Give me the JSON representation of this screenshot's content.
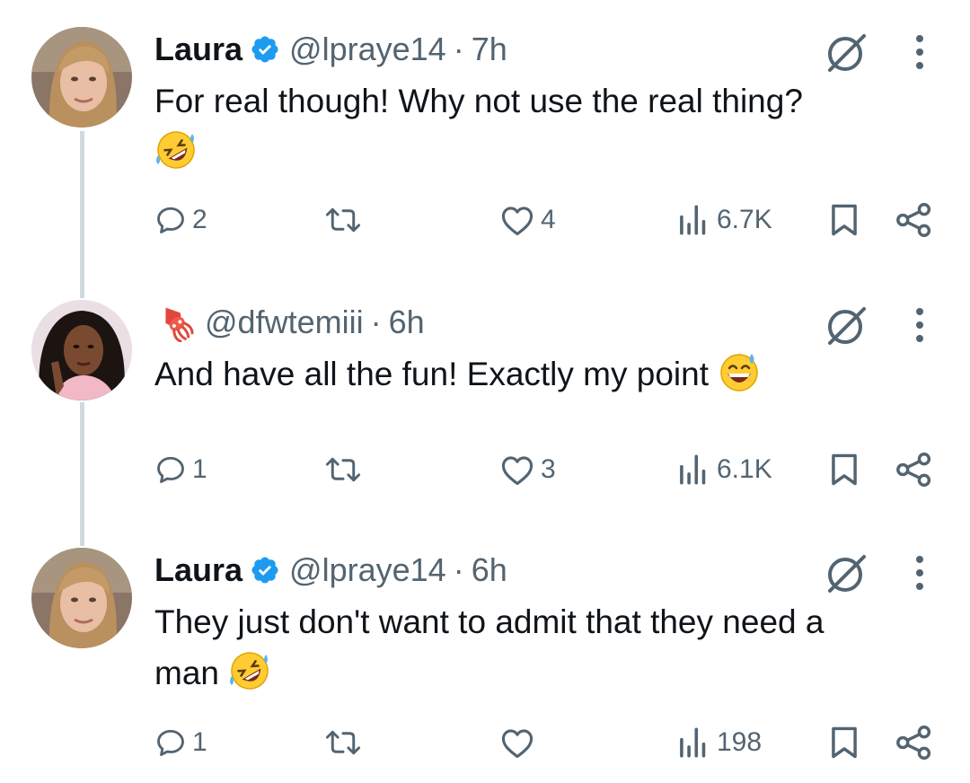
{
  "tweets": [
    {
      "author": "Laura",
      "verified": true,
      "handle": "@lpraye14",
      "time": "7h",
      "text": "For real though! Why not use the real thing?",
      "emoji": "rolling-on-floor-laughing",
      "stats": {
        "replies": "2",
        "retweets": "",
        "likes": "4",
        "views": "6.7K"
      }
    },
    {
      "author_emoji": "squid",
      "handle": "@dfwtemiii",
      "time": "6h",
      "text": "And have all the fun! Exactly my point",
      "emoji": "grinning-sweat",
      "stats": {
        "replies": "1",
        "retweets": "",
        "likes": "3",
        "views": "6.1K"
      }
    },
    {
      "author": "Laura",
      "verified": true,
      "handle": "@lpraye14",
      "time": "6h",
      "text": "They just don't want to admit that they need a",
      "text_line2": "man",
      "emoji": "rolling-on-floor-laughing",
      "stats": {
        "replies": "1",
        "retweets": "",
        "likes": "",
        "views": "198"
      }
    }
  ],
  "separator": "·",
  "colors": {
    "text": "#0f1419",
    "muted": "#536471",
    "verified": "#1d9bf0",
    "thread_line": "#cfd9de"
  },
  "icons": [
    "verified-badge-icon",
    "squid-icon",
    "grok-icon",
    "more-icon",
    "reply-icon",
    "retweet-icon",
    "like-icon",
    "views-icon",
    "bookmark-icon",
    "share-icon"
  ]
}
